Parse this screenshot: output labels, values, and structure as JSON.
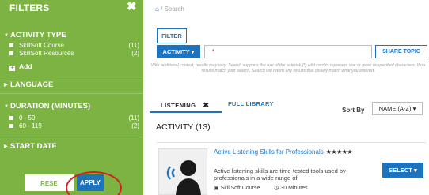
{
  "filters": {
    "title": "FILTERS",
    "close": "✖",
    "sections": {
      "activity_type": "ACTIVITY TYPE",
      "language": "LANGUAGE",
      "duration": "DURATION (MINUTES)",
      "start_date": "START DATE"
    },
    "activity_options": [
      {
        "label": "SkillSoft Course",
        "count": "(11)"
      },
      {
        "label": "SkillSoft Resources",
        "count": "(2)"
      }
    ],
    "add_label": "Add",
    "duration_options": [
      {
        "label": "0 - 59",
        "count": "(11)"
      },
      {
        "label": "60 - 119",
        "count": "(2)"
      }
    ],
    "reset_label": "RESE",
    "apply_label": "APPLY",
    "annotation_color": "#d62020"
  },
  "breadcrumb": {
    "current": "Search"
  },
  "toolbar": {
    "filter_label": "FILTER",
    "activity_label": "ACTIVITY ▾",
    "search_value": "*",
    "share_label": "SHARE TOPIC",
    "hint": "With additional context, results may vary. Search supports the use of the asterisk (*) wild card to represent one or more unspecified characters. If no results match your search, Search will return any results that closely match what you entered."
  },
  "tabs": {
    "listening": "LISTENING",
    "listening_close": "✖",
    "full_library": "FULL LIBRARY"
  },
  "sort": {
    "label": "Sort By",
    "value": "NAME (A-Z) ▾"
  },
  "results": {
    "heading": "ACTIVITY (13)",
    "card": {
      "title": "Active Listening Skills for Professionals",
      "stars": "★★★★★",
      "rating": 5,
      "description": "Active listening skills are time-tested tools used by professionals in a wide range of",
      "type": "SkillSoft Course",
      "duration": "30 Minutes",
      "select_label": "SELECT ▾"
    }
  },
  "colors": {
    "filter_green": "#7cb342",
    "primary_blue": "#1e73be"
  }
}
